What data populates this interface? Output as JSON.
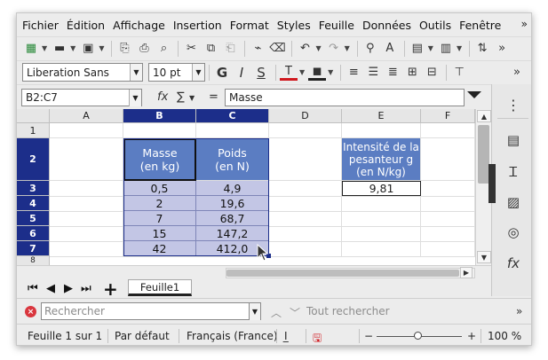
{
  "menubar": {
    "items": [
      "Fichier",
      "Édition",
      "Affichage",
      "Insertion",
      "Format",
      "Styles",
      "Feuille",
      "Données",
      "Outils",
      "Fenêtre"
    ],
    "more": "»"
  },
  "toolbar": {
    "font_name": "Liberation Sans",
    "font_size": "10 pt",
    "bold": "G",
    "italic": "I",
    "underline": "S",
    "more": "»"
  },
  "formula_bar": {
    "name_box": "B2:C7",
    "fx": "fx",
    "sum": "∑",
    "equals": "=",
    "content": "Masse"
  },
  "sheet": {
    "columns": [
      "A",
      "B",
      "C",
      "D",
      "E",
      "F"
    ],
    "rows": [
      "1",
      "2",
      "3",
      "4",
      "5",
      "6",
      "7",
      "8"
    ],
    "table_headers": [
      "Masse\n(en kg)",
      "Poids\n(en N)"
    ],
    "table_rows": [
      [
        "0,5",
        "4,9"
      ],
      [
        "2",
        "19,6"
      ],
      [
        "7",
        "68,7"
      ],
      [
        "15",
        "147,2"
      ],
      [
        "42",
        "412,0"
      ]
    ],
    "g_header": "Intensité de la pesanteur g (en N/kg)",
    "g_value": "9,81"
  },
  "tabs": {
    "sheet_name": "Feuille1",
    "add": "+"
  },
  "findbar": {
    "placeholder": "Rechercher",
    "search_all": "Tout rechercher",
    "more": "»"
  },
  "statusbar": {
    "sheet_info": "Feuille 1 sur 1",
    "page_style": "Par défaut",
    "language": "Français (France)",
    "zoom_minus": "−",
    "zoom_plus": "+",
    "zoom": "100 %"
  },
  "colors": {
    "header_fill": "#5b7dc2",
    "data_fill": "#c3c6e5",
    "selection_header": "#1c2e8a"
  }
}
